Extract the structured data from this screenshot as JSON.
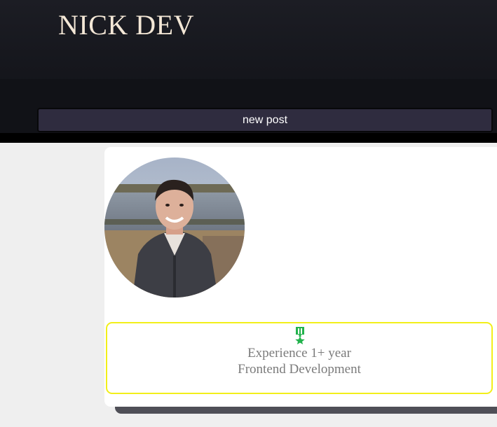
{
  "header": {
    "site_title": "NICK DEV",
    "new_post_label": "new post"
  },
  "profile": {
    "avatar_alt": "profile photo"
  },
  "experience": {
    "icon": "medal-star-icon",
    "line1": "Experience 1+ year",
    "line2": "Frontend Development"
  },
  "colors": {
    "header_bg": "#1a1b22",
    "title_color": "#f3e7d6",
    "button_bg": "#2f2c3f",
    "experience_border": "#f2ef1a",
    "medal_green": "#22b24c",
    "page_bg": "#efefef"
  }
}
